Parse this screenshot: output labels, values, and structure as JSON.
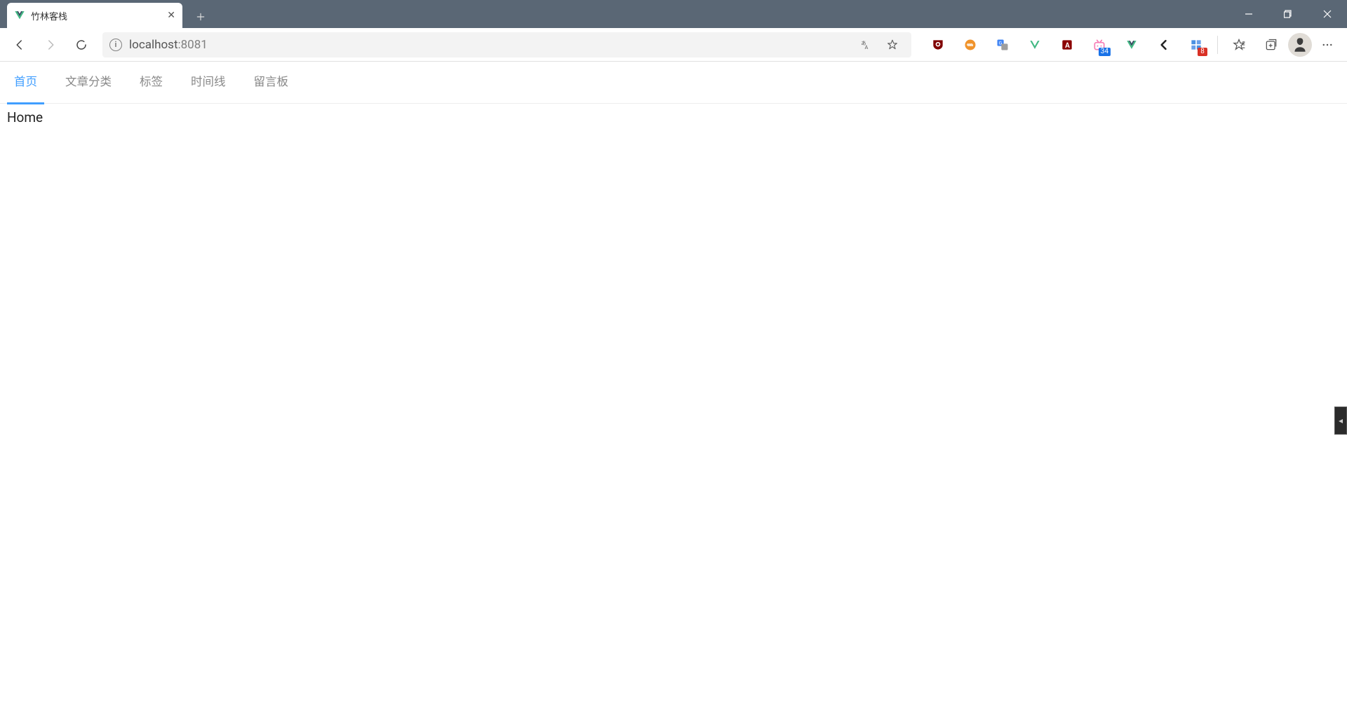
{
  "window": {
    "tab_title": "竹林客栈"
  },
  "address": {
    "host": "localhost",
    "port": ":8081"
  },
  "extensions": {
    "badge1": "34",
    "badge2": "8"
  },
  "nav": {
    "tabs": [
      {
        "label": "首页",
        "active": true
      },
      {
        "label": "文章分类",
        "active": false
      },
      {
        "label": "标签",
        "active": false
      },
      {
        "label": "时间线",
        "active": false
      },
      {
        "label": "留言板",
        "active": false
      }
    ]
  },
  "content": {
    "heading": "Home"
  },
  "colors": {
    "titlebar": "#5a6775",
    "active_tab": "#409eff"
  }
}
